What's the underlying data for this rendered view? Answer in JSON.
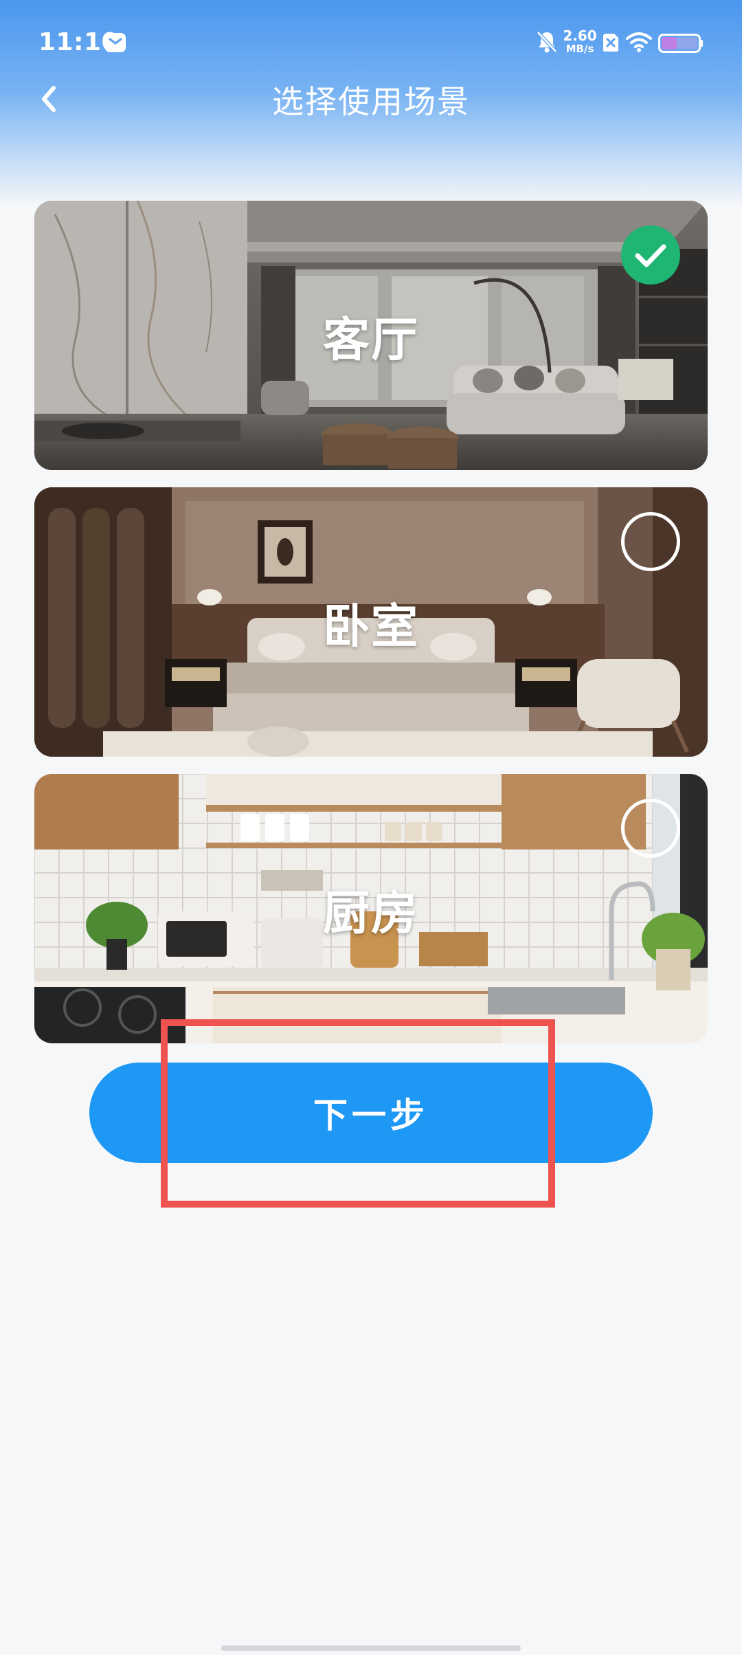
{
  "status_bar": {
    "time": "11:10",
    "network_speed_value": "2.60",
    "network_speed_unit": "MB/s"
  },
  "header": {
    "title": "选择使用场景"
  },
  "scenes": [
    {
      "label": "客厅",
      "selected": true
    },
    {
      "label": "卧室",
      "selected": false
    },
    {
      "label": "厨房",
      "selected": false
    }
  ],
  "next_button": {
    "label": "下一步"
  },
  "colors": {
    "header_blue": "#4b97ef",
    "primary_button": "#1e98f5",
    "selected_check": "#1fb573",
    "highlight_box": "#ee5350",
    "page_background": "#f6f7f9"
  },
  "icons": [
    "mail-icon",
    "bell-muted-icon",
    "sim-icon",
    "wifi-icon",
    "battery-icon",
    "back-arrow-icon",
    "checkmark-icon"
  ]
}
